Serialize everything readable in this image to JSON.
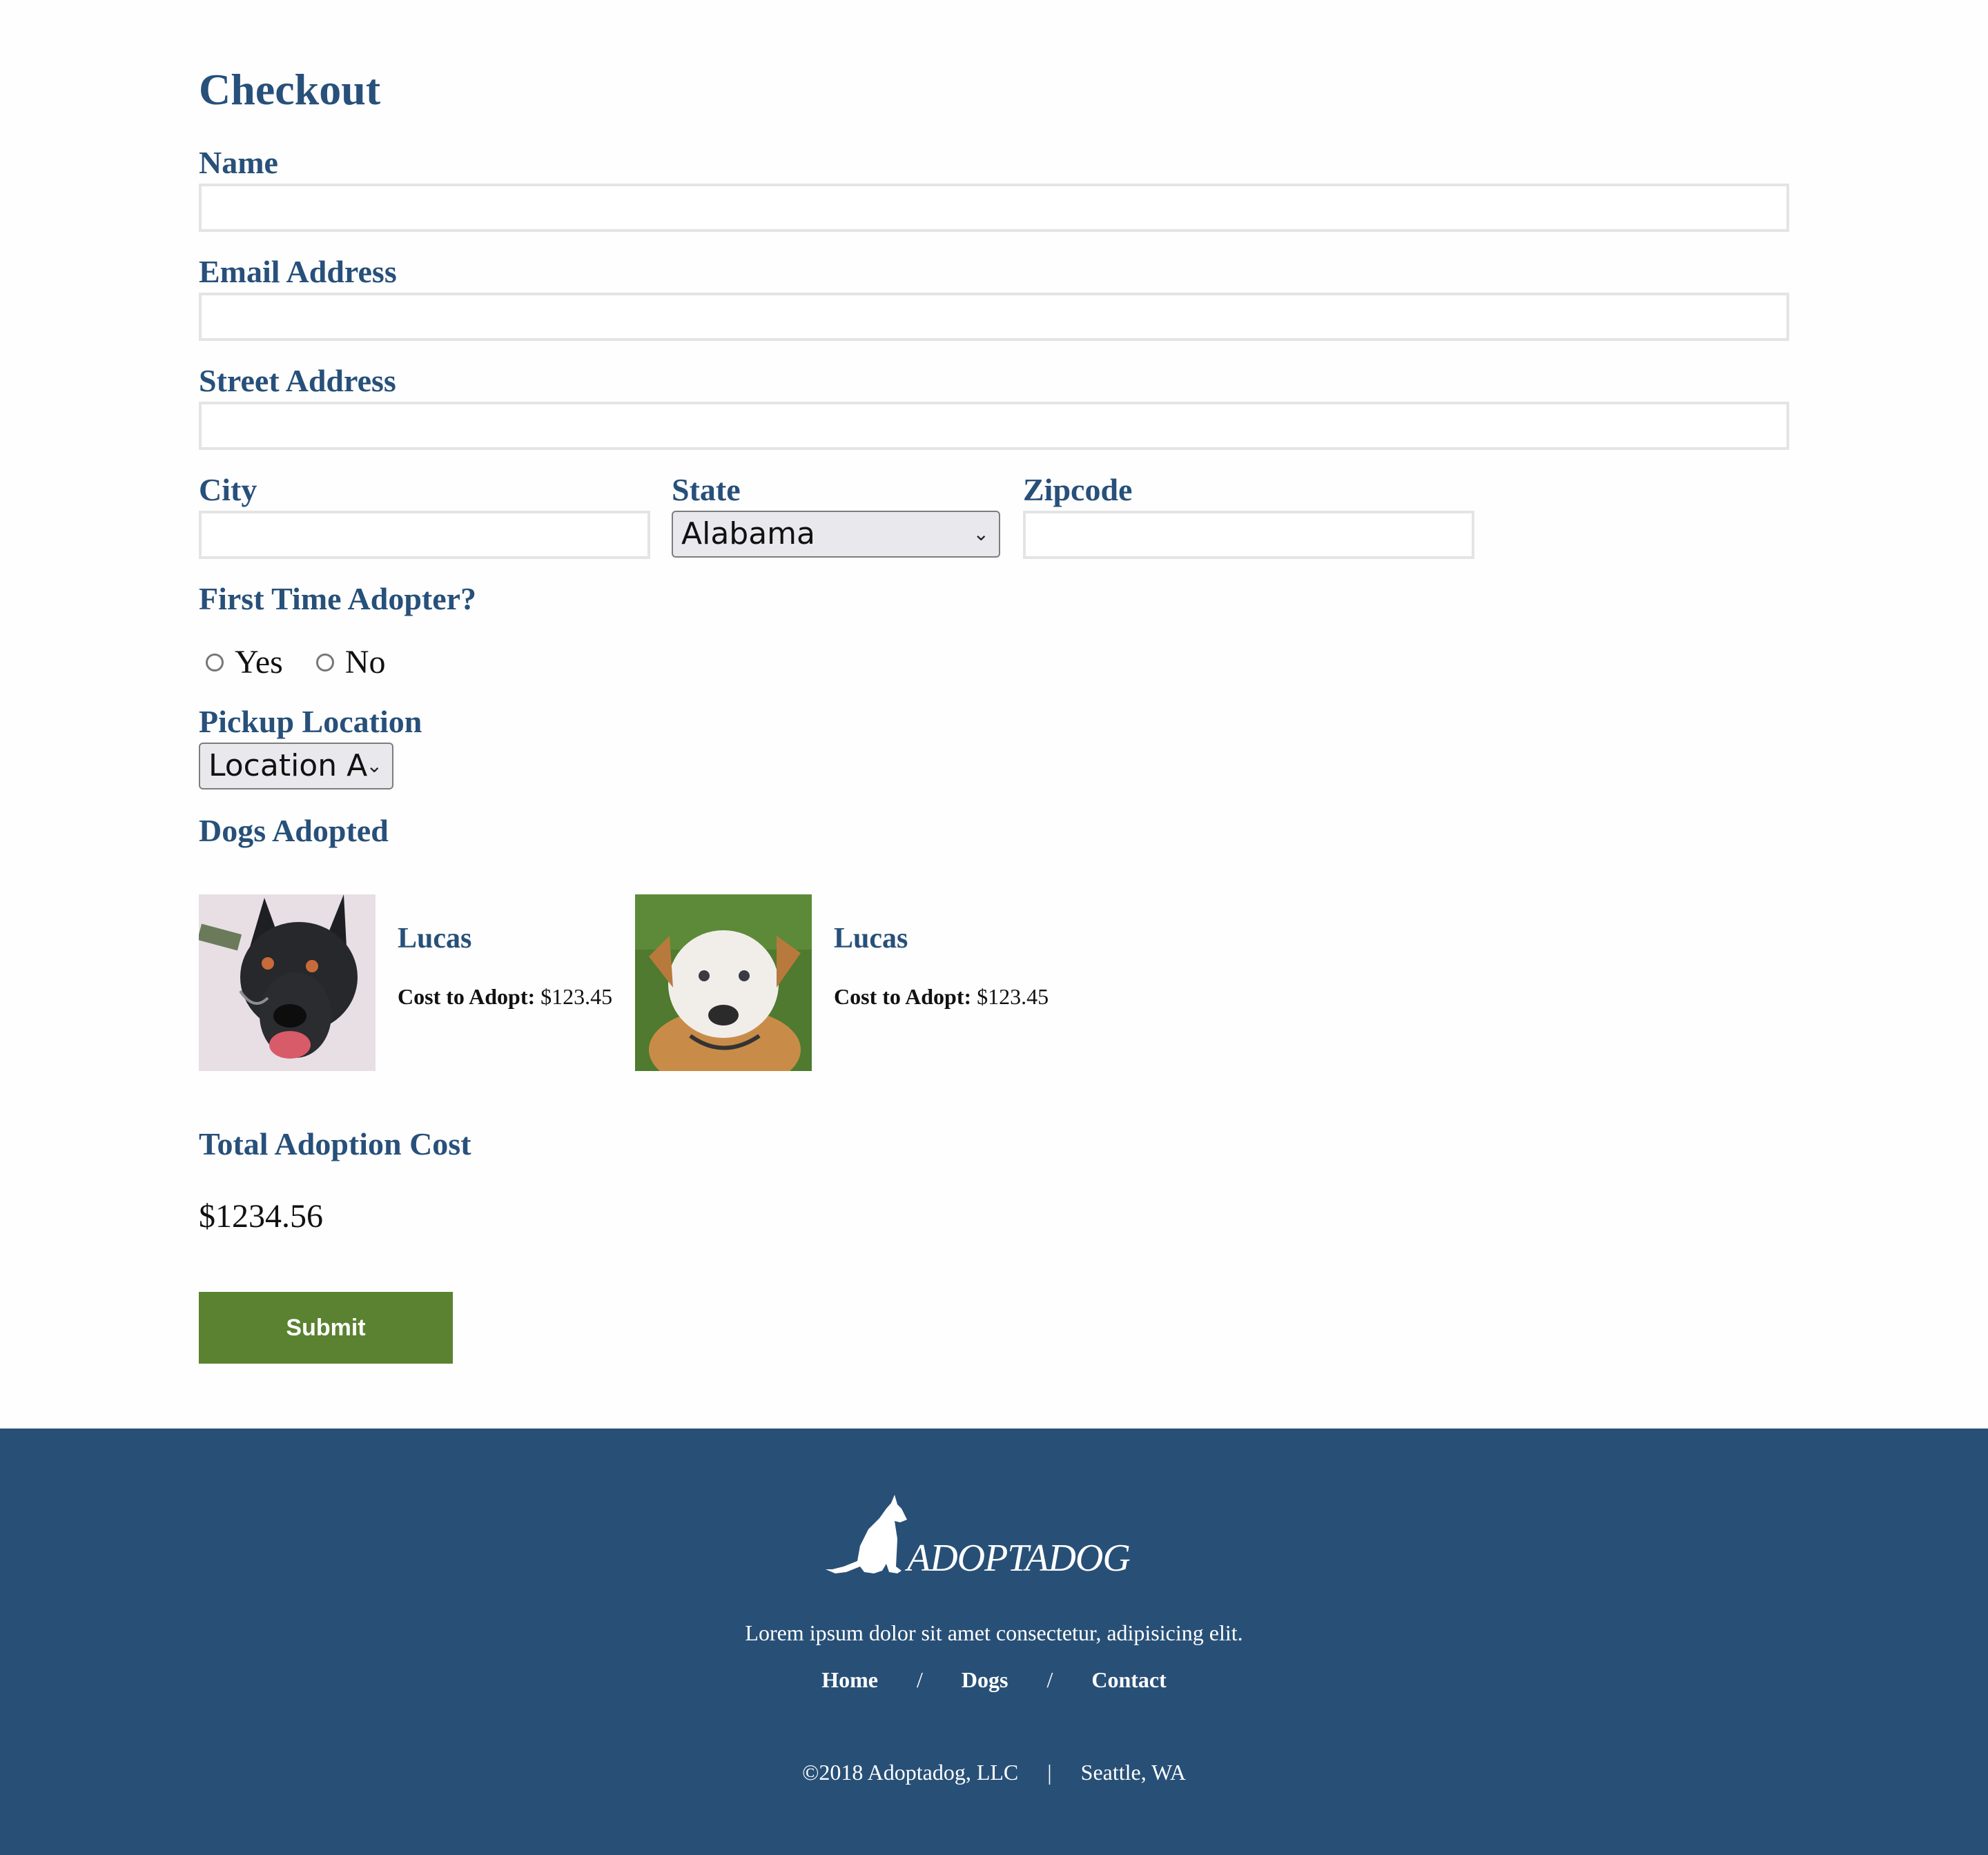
{
  "page": {
    "title": "Checkout"
  },
  "form": {
    "name_label": "Name",
    "email_label": "Email Address",
    "street_label": "Street Address",
    "city_label": "City",
    "state_label": "State",
    "state_value": "Alabama",
    "zip_label": "Zipcode",
    "first_time_label": "First Time Adopter?",
    "radio_yes": "Yes",
    "radio_no": "No",
    "pickup_label": "Pickup Location",
    "pickup_value": "Location A",
    "dogs_label": "Dogs Adopted",
    "total_label": "Total Adoption Cost",
    "total_value": "$1234.56",
    "submit_label": "Submit"
  },
  "dogs": [
    {
      "name": "Lucas",
      "cost_label": "Cost to Adopt:",
      "cost_value": "$123.45"
    },
    {
      "name": "Lucas",
      "cost_label": "Cost to Adopt:",
      "cost_value": "$123.45"
    }
  ],
  "footer": {
    "logo_text": "ADOPTADOG",
    "tagline": "Lorem ipsum dolor sit amet consectetur, adipisicing elit.",
    "nav": [
      "Home",
      "Dogs",
      "Contact"
    ],
    "nav_separator": "/",
    "copyright": "©2018 Adoptadog, LLC",
    "copyright_separator": "|",
    "location": "Seattle, WA"
  },
  "colors": {
    "primary": "#27507a",
    "footer_bg": "#285077",
    "submit_bg": "#5a8230",
    "input_border": "#e4e4e4"
  }
}
